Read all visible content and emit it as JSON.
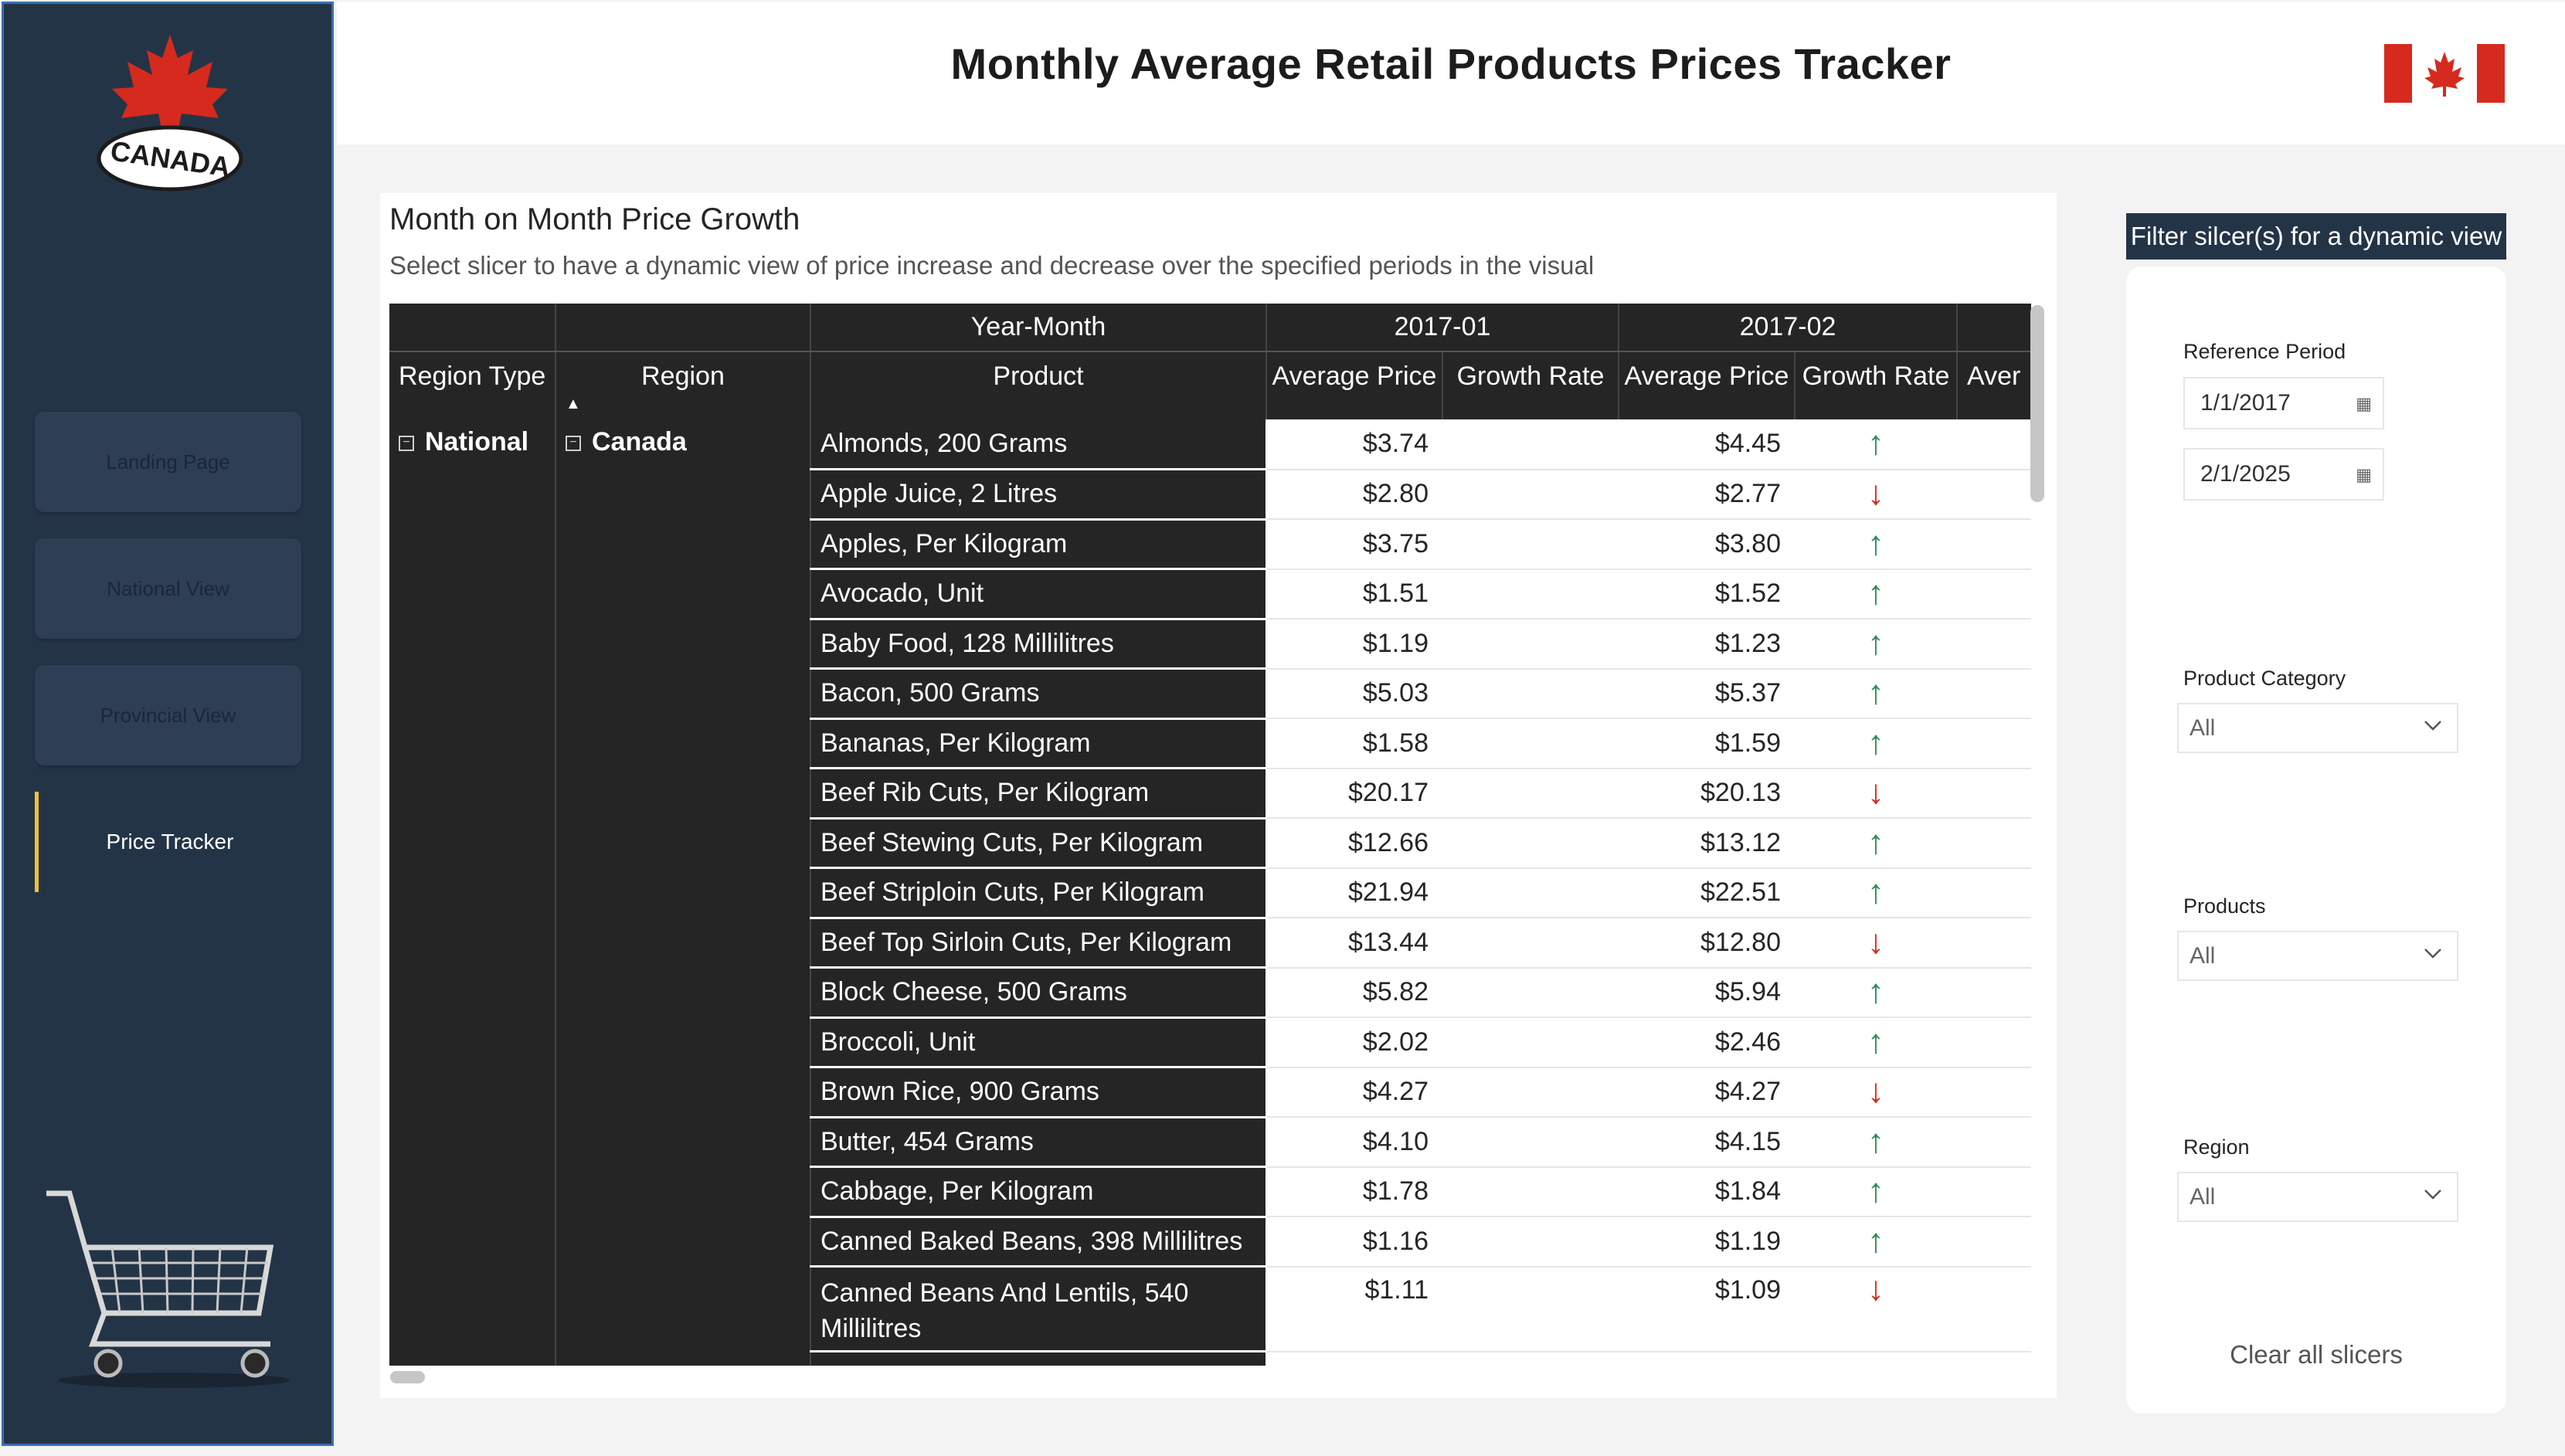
{
  "sidebar": {
    "logo_text": "CANADA",
    "nav": [
      {
        "label": "Landing Page"
      },
      {
        "label": "National View"
      },
      {
        "label": "Provincial View"
      },
      {
        "label": "Price Tracker"
      }
    ]
  },
  "header": {
    "title": "Monthly Average Retail Products Prices Tracker"
  },
  "visual": {
    "title": "Month on Month Price Growth",
    "subtitle": "Select slicer to have a dynamic view of price increase and decrease over the specified periods in the visual",
    "col_group_label": "Year-Month",
    "periods": [
      "2017-01",
      "2017-02"
    ],
    "headers": {
      "region_type": "Region Type",
      "region": "Region",
      "product": "Product",
      "avg_price": "Average Price",
      "growth_rate": "Growth Rate",
      "truncated": "Aver"
    },
    "region_type": "National",
    "region": "Canada",
    "rows": [
      {
        "product": "Almonds, 200 Grams",
        "p1": "$3.74",
        "p2": "$4.45",
        "dir": "up"
      },
      {
        "product": "Apple Juice, 2 Litres",
        "p1": "$2.80",
        "p2": "$2.77",
        "dir": "down"
      },
      {
        "product": "Apples, Per Kilogram",
        "p1": "$3.75",
        "p2": "$3.80",
        "dir": "up"
      },
      {
        "product": "Avocado, Unit",
        "p1": "$1.51",
        "p2": "$1.52",
        "dir": "up"
      },
      {
        "product": "Baby Food, 128 Millilitres",
        "p1": "$1.19",
        "p2": "$1.23",
        "dir": "up"
      },
      {
        "product": "Bacon, 500 Grams",
        "p1": "$5.03",
        "p2": "$5.37",
        "dir": "up"
      },
      {
        "product": "Bananas, Per Kilogram",
        "p1": "$1.58",
        "p2": "$1.59",
        "dir": "up"
      },
      {
        "product": "Beef Rib Cuts, Per Kilogram",
        "p1": "$20.17",
        "p2": "$20.13",
        "dir": "down"
      },
      {
        "product": "Beef Stewing Cuts, Per Kilogram",
        "p1": "$12.66",
        "p2": "$13.12",
        "dir": "up"
      },
      {
        "product": "Beef Striploin Cuts, Per Kilogram",
        "p1": "$21.94",
        "p2": "$22.51",
        "dir": "up"
      },
      {
        "product": "Beef Top Sirloin Cuts, Per Kilogram",
        "p1": "$13.44",
        "p2": "$12.80",
        "dir": "down"
      },
      {
        "product": "Block Cheese, 500 Grams",
        "p1": "$5.82",
        "p2": "$5.94",
        "dir": "up"
      },
      {
        "product": "Broccoli, Unit",
        "p1": "$2.02",
        "p2": "$2.46",
        "dir": "up"
      },
      {
        "product": "Brown Rice, 900 Grams",
        "p1": "$4.27",
        "p2": "$4.27",
        "dir": "down"
      },
      {
        "product": "Butter, 454 Grams",
        "p1": "$4.10",
        "p2": "$4.15",
        "dir": "up"
      },
      {
        "product": "Cabbage, Per Kilogram",
        "p1": "$1.78",
        "p2": "$1.84",
        "dir": "up"
      },
      {
        "product": "Canned Baked Beans, 398 Millilitres",
        "p1": "$1.16",
        "p2": "$1.19",
        "dir": "up"
      },
      {
        "product": "Canned Beans And Lentils, 540 Millilitres",
        "p1": "$1.11",
        "p2": "$1.09",
        "dir": "down"
      }
    ]
  },
  "filters": {
    "header": "Filter silcer(s) for a dynamic view",
    "reference_period_label": "Reference Period",
    "start_date": "1/1/2017",
    "end_date": "2/1/2025",
    "product_category_label": "Product Category",
    "product_category_value": "All",
    "products_label": "Products",
    "products_value": "All",
    "region_label": "Region",
    "region_value": "All",
    "clear_label": "Clear all slicers"
  },
  "colors": {
    "sidebar_bg": "#243447",
    "matrix_header_bg": "#252525",
    "arrow_up": "#2e8b57",
    "arrow_down": "#d52a1d",
    "active_nav_accent": "#f2c230"
  }
}
